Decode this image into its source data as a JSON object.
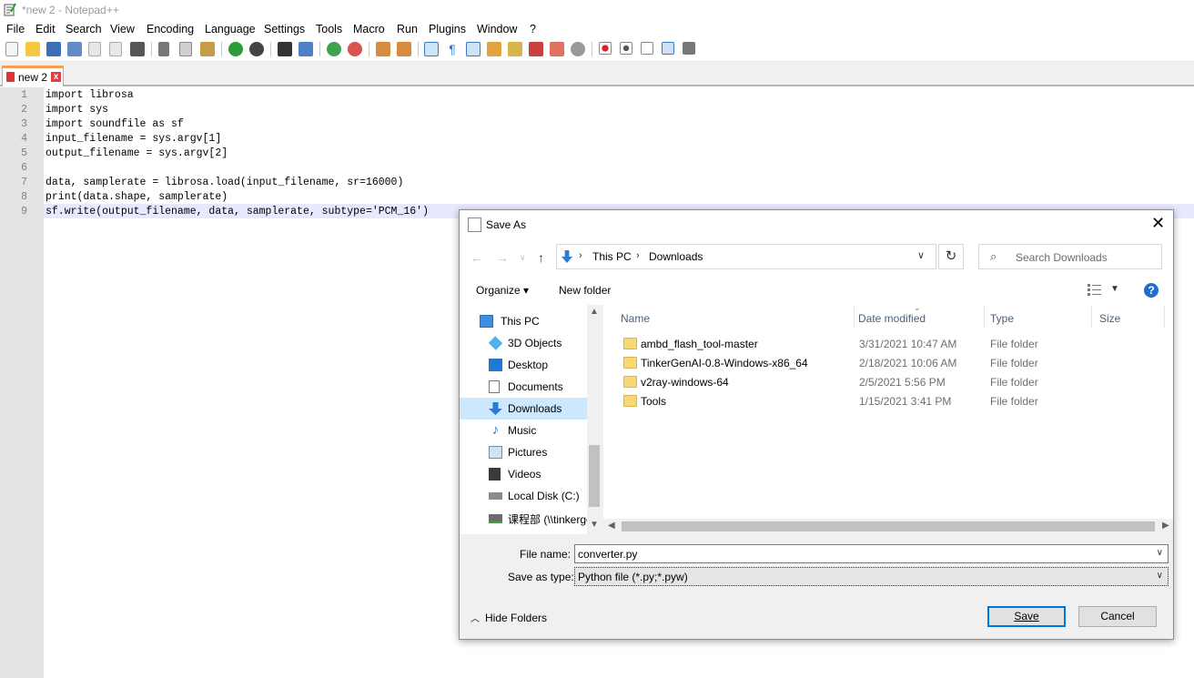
{
  "window": {
    "title": "*new 2 - Notepad++"
  },
  "menu": [
    "File",
    "Edit",
    "Search",
    "View",
    "Encoding",
    "Language",
    "Settings",
    "Tools",
    "Macro",
    "Run",
    "Plugins",
    "Window",
    "?"
  ],
  "tab": {
    "label": "new 2",
    "close": "x"
  },
  "editor": {
    "line_numbers": [
      "1",
      "2",
      "3",
      "4",
      "5",
      "6",
      "7",
      "8",
      "9"
    ],
    "lines": [
      "import librosa",
      "import sys",
      "import soundfile as sf",
      "input_filename = sys.argv[1]",
      "output_filename = sys.argv[2]",
      "",
      "data, samplerate = librosa.load(input_filename, sr=16000)",
      "print(data.shape, samplerate)",
      "sf.write(output_filename, data, samplerate, subtype='PCM_16')"
    ]
  },
  "dialog": {
    "title": "Save As",
    "close": "✕",
    "breadcrumb": [
      "This PC",
      "Downloads"
    ],
    "search_placeholder": "Search Downloads",
    "organize": "Organize ▾",
    "new_folder": "New folder",
    "help": "?",
    "nav_items": [
      {
        "label": "This PC",
        "icon": "pc-icon"
      },
      {
        "label": "3D Objects",
        "icon": "cube-icon"
      },
      {
        "label": "Desktop",
        "icon": "desktop-icon"
      },
      {
        "label": "Documents",
        "icon": "document-icon"
      },
      {
        "label": "Downloads",
        "icon": "download-icon",
        "selected": true
      },
      {
        "label": "Music",
        "icon": "music-icon"
      },
      {
        "label": "Pictures",
        "icon": "picture-icon"
      },
      {
        "label": "Videos",
        "icon": "video-icon"
      },
      {
        "label": "Local Disk (C:)",
        "icon": "disk-icon"
      },
      {
        "label": "课程部 (\\\\tinkergen",
        "icon": "network-drive-icon"
      }
    ],
    "columns": [
      "Name",
      "Date modified",
      "Type",
      "Size"
    ],
    "files": [
      {
        "name": "ambd_flash_tool-master",
        "date": "3/31/2021 10:47 AM",
        "type": "File folder"
      },
      {
        "name": "TinkerGenAI-0.8-Windows-x86_64",
        "date": "2/18/2021 10:06 AM",
        "type": "File folder"
      },
      {
        "name": "v2ray-windows-64",
        "date": "2/5/2021 5:56 PM",
        "type": "File folder"
      },
      {
        "name": "Tools",
        "date": "1/15/2021 3:41 PM",
        "type": "File folder"
      }
    ],
    "file_name_label": "File name:",
    "file_name_value": "converter.py",
    "save_type_label": "Save as type:",
    "save_type_value": "Python file (*.py;*.pyw)",
    "hide_folders": "Hide Folders",
    "save_button": "Save",
    "cancel_button": "Cancel"
  },
  "colors": {
    "accent": "#0078d7",
    "selection": "#cce8ff",
    "tab_accent": "#f6a04d",
    "gutter": "#e4e4e4"
  }
}
